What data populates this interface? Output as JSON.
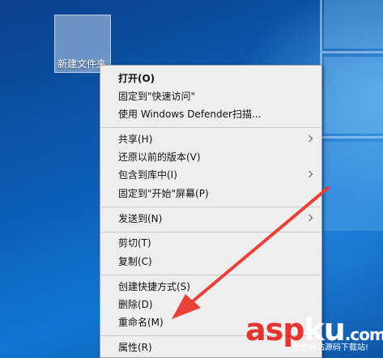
{
  "desktop": {
    "folder_label": "新建文件夹"
  },
  "context_menu": {
    "items": [
      {
        "label": "打开(O)",
        "bold": true
      },
      {
        "label": "固定到\"快速访问\""
      },
      {
        "label": "使用 Windows Defender扫描..."
      },
      {
        "label": "共享(H)",
        "submenu": true
      },
      {
        "label": "还原以前的版本(V)"
      },
      {
        "label": "包含到库中(I)",
        "submenu": true
      },
      {
        "label": "固定到\"开始\"屏幕(P)"
      },
      {
        "label": "发送到(N)",
        "submenu": true
      },
      {
        "label": "剪切(T)"
      },
      {
        "label": "复制(C)"
      },
      {
        "label": "创建快捷方式(S)"
      },
      {
        "label": "删除(D)"
      },
      {
        "label": "重命名(M)"
      },
      {
        "label": "属性(R)"
      }
    ]
  },
  "watermark": {
    "part1": "asp",
    "part2": "ku",
    "suffix": ".com",
    "tagline": "免费网站源码下载站!"
  },
  "colors": {
    "menu_bg": "#eeeeee",
    "arrow": "#e8413a",
    "watermark_red": "#e3342f"
  }
}
